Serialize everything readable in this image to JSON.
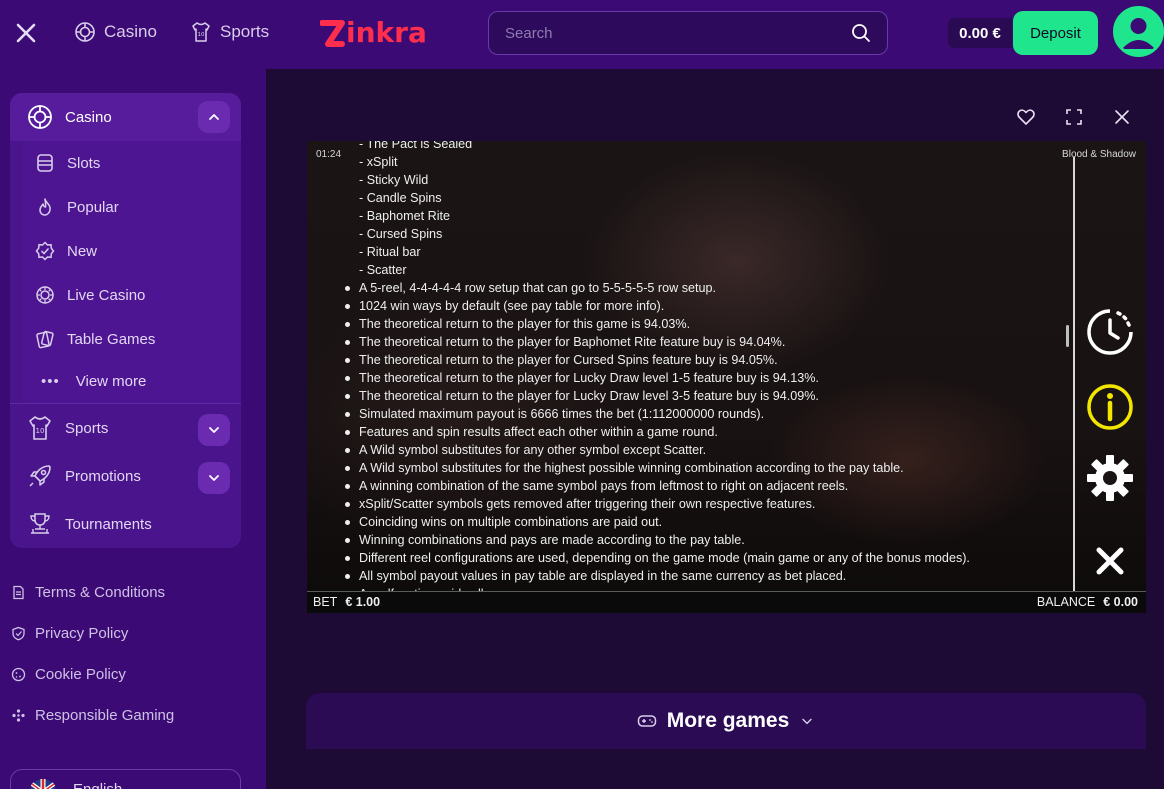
{
  "header": {
    "nav": [
      {
        "label": "Casino",
        "icon": "casino-chip-icon"
      },
      {
        "label": "Sports",
        "icon": "jersey-icon"
      }
    ],
    "logo_text": "inkra",
    "search_placeholder": "Search",
    "balance": "0.00 €",
    "deposit_label": "Deposit"
  },
  "sidebar": {
    "casino_label": "Casino",
    "casino_items": [
      {
        "label": "Slots",
        "icon": "slots-icon"
      },
      {
        "label": "Popular",
        "icon": "flame-icon"
      },
      {
        "label": "New",
        "icon": "new-badge-icon"
      },
      {
        "label": "Live Casino",
        "icon": "live-chip-icon"
      },
      {
        "label": "Table Games",
        "icon": "cards-icon"
      }
    ],
    "view_more_label": "View more",
    "sports_label": "Sports",
    "promotions_label": "Promotions",
    "tournaments_label": "Tournaments",
    "footer_links": [
      {
        "label": "Terms & Conditions",
        "icon": "document-icon"
      },
      {
        "label": "Privacy Policy",
        "icon": "shield-icon"
      },
      {
        "label": "Cookie Policy",
        "icon": "cookie-icon"
      },
      {
        "label": "Responsible Gaming",
        "icon": "responsible-icon"
      }
    ],
    "language_label": "English"
  },
  "game": {
    "time": "01:24",
    "title": "Blood & Shadow",
    "sub_items": [
      "- The Pact is Sealed",
      "- xSplit",
      "- Sticky Wild",
      "- Candle Spins",
      "- Baphomet Rite",
      "- Cursed Spins",
      "- Ritual bar",
      "- Scatter"
    ],
    "rules": [
      "A 5-reel, 4-4-4-4-4 row setup that can go to 5-5-5-5-5 row setup.",
      "1024 win ways by default (see pay table for more info).",
      "The theoretical return to the player for this game is 94.03%.",
      "The theoretical return to the player for Baphomet Rite feature buy is 94.04%.",
      "The theoretical return to the player for Cursed Spins feature buy is 94.05%.",
      "The theoretical return to the player for Lucky Draw level 1-5 feature buy is 94.13%.",
      "The theoretical return to the player for Lucky Draw level 3-5 feature buy is 94.09%.",
      "Simulated maximum payout is 6666 times the bet (1:112000000 rounds).",
      "Features and spin results affect each other within a game round.",
      "A Wild symbol substitutes for any other symbol except Scatter.",
      "A Wild symbol substitutes for the highest possible winning combination according to the pay table.",
      "A winning combination of the same symbol pays from leftmost to right on adjacent reels.",
      "xSplit/Scatter symbols gets removed after triggering their own respective features.",
      "Coinciding wins on multiple combinations are paid out.",
      "Winning combinations and pays are made according to the pay table.",
      "Different reel configurations are used, depending on the game mode (main game or any of the bonus modes).",
      "All symbol payout values in pay table are displayed in the same currency as bet placed.",
      "A malfunction voids all pays."
    ],
    "bet_label": "BET",
    "bet_value": "€ 1.00",
    "balance_label": "BALANCE",
    "balance_value": "€ 0.00"
  },
  "more_games_label": "More games",
  "colors": {
    "accent": "#1fe68c",
    "brand": "#ff2e4d",
    "sidebar": "#3c0a75",
    "info": "#f2e600"
  }
}
